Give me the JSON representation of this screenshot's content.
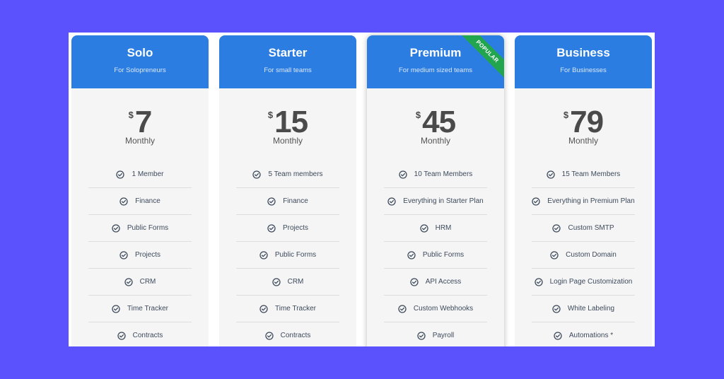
{
  "colors": {
    "background": "#5b52fd",
    "header": "#2b7de1",
    "ribbon": "#22a54f",
    "card_body": "#f5f5f5"
  },
  "plans": [
    {
      "name": "Solo",
      "subtitle": "For Solopreneurs",
      "currency": "$",
      "price": "7",
      "period": "Monthly",
      "features": [
        "1 Member",
        "Finance",
        "Public Forms",
        "Projects",
        "CRM",
        "Time Tracker",
        "Contracts"
      ]
    },
    {
      "name": "Starter",
      "subtitle": "For small teams",
      "currency": "$",
      "price": "15",
      "period": "Monthly",
      "features": [
        "5 Team members",
        "Finance",
        "Projects",
        "Public Forms",
        "CRM",
        "Time Tracker",
        "Contracts"
      ]
    },
    {
      "name": "Premium",
      "subtitle": "For medium sized teams",
      "currency": "$",
      "price": "45",
      "period": "Monthly",
      "badge": "POPULAR",
      "features": [
        "10 Team Members",
        "Everything in Starter Plan",
        "HRM",
        "Public Forms",
        "API Access",
        "Custom Webhooks",
        "Payroll"
      ]
    },
    {
      "name": "Business",
      "subtitle": "For Businesses",
      "currency": "$",
      "price": "79",
      "period": "Monthly",
      "features": [
        "15 Team Members",
        "Everything in Premium Plan",
        "Custom SMTP",
        "Custom Domain",
        "Login Page Customization",
        "White Labeling",
        "Automations *"
      ]
    }
  ]
}
